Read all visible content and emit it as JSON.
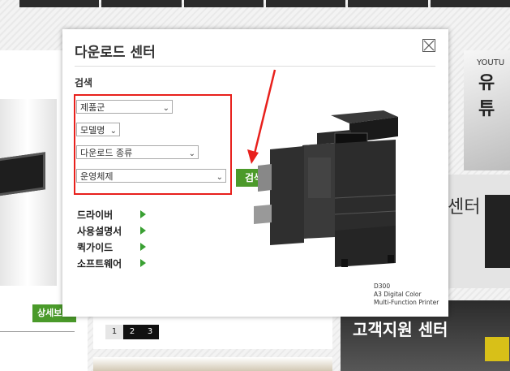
{
  "modal": {
    "title": "다운로드 센터",
    "search_heading": "검색",
    "selects": [
      {
        "value": "제품군"
      },
      {
        "value": "모델명"
      },
      {
        "value": "다운로드 종류"
      },
      {
        "value": "운영체제"
      }
    ],
    "search_button": "검색",
    "categories": [
      "드라이버",
      "사용설명서",
      "퀵가이드",
      "소프트웨어"
    ],
    "product": {
      "model": "D300",
      "line1": "A3 Digital Color",
      "line2": "Multi-Function Printer"
    },
    "annotation_color": "#e8201c"
  },
  "background": {
    "detail_button": "상세보",
    "pager": [
      "1",
      "2",
      "3"
    ],
    "youtube_small": "YOUTU",
    "youtube_big": "유튜",
    "center_text": "센터",
    "support_text": "고객지원 센터"
  }
}
